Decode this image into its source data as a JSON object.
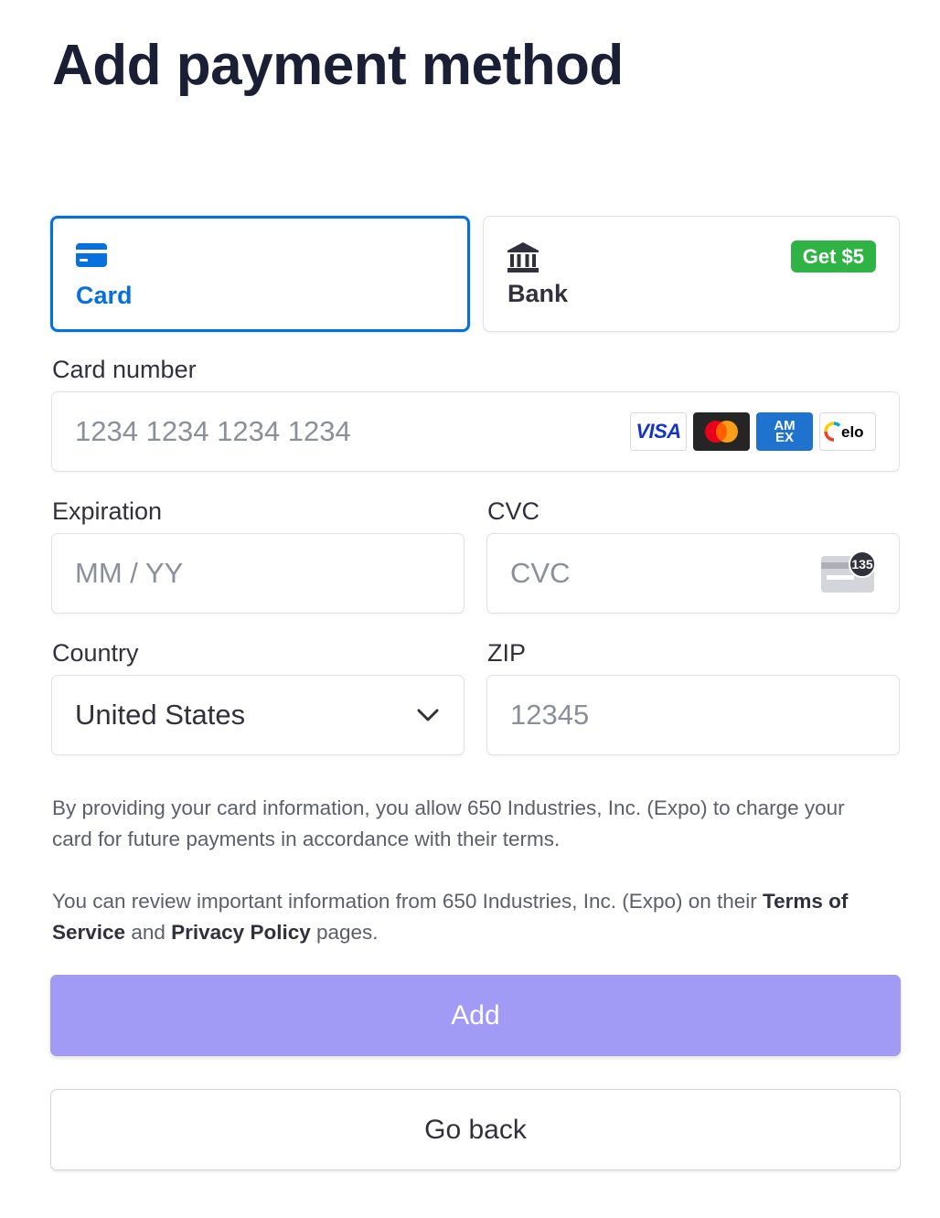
{
  "page": {
    "title": "Add payment method"
  },
  "tabs": [
    {
      "label": "Card",
      "icon": "card-icon",
      "selected": true
    },
    {
      "label": "Bank",
      "icon": "bank-icon",
      "selected": false,
      "badge": "Get $5"
    }
  ],
  "form": {
    "card_number": {
      "label": "Card number",
      "placeholder": "1234 1234 1234 1234",
      "value": "",
      "brands": [
        "visa",
        "mastercard",
        "amex",
        "elo"
      ]
    },
    "expiration": {
      "label": "Expiration",
      "placeholder": "MM / YY",
      "value": ""
    },
    "cvc": {
      "label": "CVC",
      "placeholder": "CVC",
      "value": "",
      "icon_badge": "135"
    },
    "country": {
      "label": "Country",
      "value": "United States"
    },
    "zip": {
      "label": "ZIP",
      "placeholder": "12345",
      "value": ""
    }
  },
  "legal": {
    "consent": "By providing your card information, you allow 650 Industries, Inc. (Expo) to charge your card for future payments in accordance with their terms.",
    "review_prefix": "You can review important information from 650 Industries, Inc. (Expo) on their ",
    "terms_link": "Terms of Service",
    "and_text": " and ",
    "privacy_link": "Privacy Policy",
    "review_suffix": " pages."
  },
  "buttons": {
    "add": "Add",
    "go_back": "Go back"
  },
  "colors": {
    "accent": "#0570de",
    "add_button": "#a29bf5",
    "badge": "#2fb344",
    "title": "#1a1f36"
  }
}
